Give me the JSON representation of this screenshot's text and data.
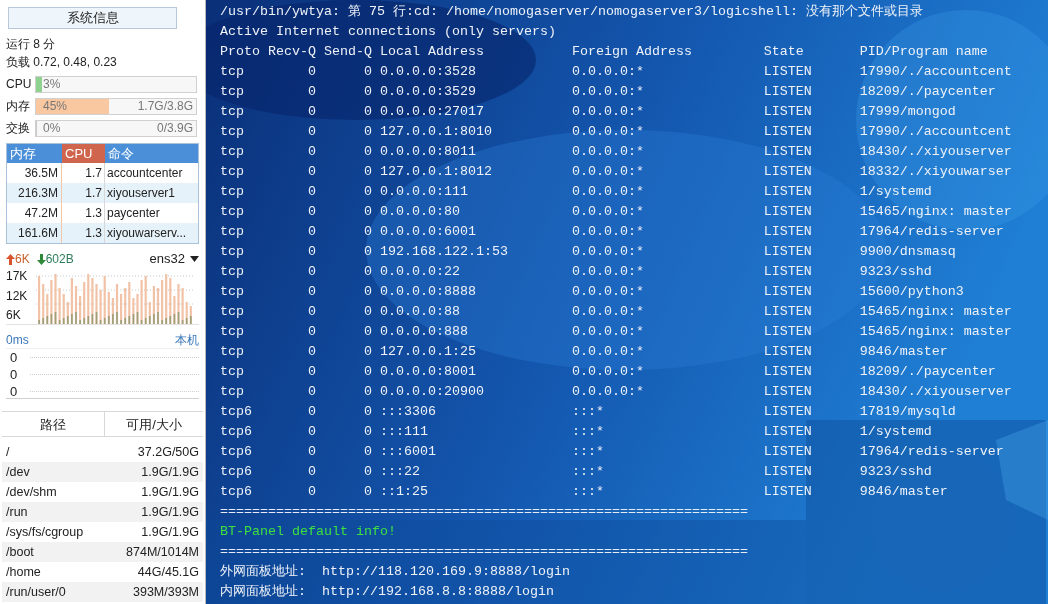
{
  "sidebar": {
    "title_button": "系统信息",
    "uptime": "运行 8 分",
    "load": "负载 0.72, 0.48, 0.23",
    "meters": [
      {
        "label": "CPU",
        "percent": "3%",
        "level": 0.03,
        "color": "#8fd18f"
      },
      {
        "label": "内存",
        "percent": "45%",
        "detail": "1.7G/3.8G",
        "level": 0.45,
        "color": "#f9c7a0"
      },
      {
        "label": "交换",
        "percent": "0%",
        "detail": "0/3.9G",
        "level": 0
      }
    ],
    "process_table": {
      "columns": [
        {
          "label": "内存",
          "selected": false
        },
        {
          "label": "CPU",
          "selected": true
        },
        {
          "label": "命令",
          "selected": false
        }
      ],
      "rows": [
        [
          "36.5M",
          "1.7",
          "accountcenter"
        ],
        [
          "216.3M",
          "1.7",
          "xiyouserver1"
        ],
        [
          "47.2M",
          "1.3",
          "paycenter"
        ],
        [
          "161.6M",
          "1.3",
          "xiyouwarserv..."
        ]
      ]
    },
    "network": {
      "upload": "6K",
      "download": "602B",
      "interface": "ens32",
      "tick_labels": [
        "17K",
        "12K",
        "6K"
      ]
    },
    "ping": {
      "latency": "0ms",
      "target": "本机",
      "values": [
        "0",
        "0",
        "0"
      ]
    },
    "disk_table": {
      "columns": [
        "路径",
        "可用/大小"
      ],
      "rows": [
        {
          "path": "/",
          "size": "37.2G/50G"
        },
        {
          "path": "/dev",
          "size": "1.9G/1.9G"
        },
        {
          "path": "/dev/shm",
          "size": "1.9G/1.9G"
        },
        {
          "path": "/run",
          "size": "1.9G/1.9G"
        },
        {
          "path": "/sys/fs/cgroup",
          "size": "1.9G/1.9G"
        },
        {
          "path": "/boot",
          "size": "874M/1014M"
        },
        {
          "path": "/home",
          "size": "44G/45.1G"
        },
        {
          "path": "/run/user/0",
          "size": "393M/393M"
        }
      ]
    }
  },
  "terminal": {
    "lines_before": [
      "/usr/bin/ywtya: 第 75 行:cd: /home/nomogaserver/nomogaserver3/logicshell: 没有那个文件或目录",
      "Active Internet connections (only servers)"
    ],
    "columns": [
      "Proto",
      "Recv-Q",
      "Send-Q",
      "Local Address",
      "Foreign Address",
      "State",
      "PID/Program name"
    ],
    "rows": [
      [
        "tcp",
        "0",
        "0",
        "0.0.0.0:3528",
        "0.0.0.0:*",
        "LISTEN",
        "17990/./accountcent"
      ],
      [
        "tcp",
        "0",
        "0",
        "0.0.0.0:3529",
        "0.0.0.0:*",
        "LISTEN",
        "18209/./paycenter"
      ],
      [
        "tcp",
        "0",
        "0",
        "0.0.0.0:27017",
        "0.0.0.0:*",
        "LISTEN",
        "17999/mongod"
      ],
      [
        "tcp",
        "0",
        "0",
        "127.0.0.1:8010",
        "0.0.0.0:*",
        "LISTEN",
        "17990/./accountcent"
      ],
      [
        "tcp",
        "0",
        "0",
        "0.0.0.0:8011",
        "0.0.0.0:*",
        "LISTEN",
        "18430/./xiyouserver"
      ],
      [
        "tcp",
        "0",
        "0",
        "127.0.0.1:8012",
        "0.0.0.0:*",
        "LISTEN",
        "18332/./xiyouwarser"
      ],
      [
        "tcp",
        "0",
        "0",
        "0.0.0.0:111",
        "0.0.0.0:*",
        "LISTEN",
        "1/systemd"
      ],
      [
        "tcp",
        "0",
        "0",
        "0.0.0.0:80",
        "0.0.0.0:*",
        "LISTEN",
        "15465/nginx: master"
      ],
      [
        "tcp",
        "0",
        "0",
        "0.0.0.0:6001",
        "0.0.0.0:*",
        "LISTEN",
        "17964/redis-server"
      ],
      [
        "tcp",
        "0",
        "0",
        "192.168.122.1:53",
        "0.0.0.0:*",
        "LISTEN",
        "9900/dnsmasq"
      ],
      [
        "tcp",
        "0",
        "0",
        "0.0.0.0:22",
        "0.0.0.0:*",
        "LISTEN",
        "9323/sshd"
      ],
      [
        "tcp",
        "0",
        "0",
        "0.0.0.0:8888",
        "0.0.0.0:*",
        "LISTEN",
        "15600/python3"
      ],
      [
        "tcp",
        "0",
        "0",
        "0.0.0.0:88",
        "0.0.0.0:*",
        "LISTEN",
        "15465/nginx: master"
      ],
      [
        "tcp",
        "0",
        "0",
        "0.0.0.0:888",
        "0.0.0.0:*",
        "LISTEN",
        "15465/nginx: master"
      ],
      [
        "tcp",
        "0",
        "0",
        "127.0.0.1:25",
        "0.0.0.0:*",
        "LISTEN",
        "9846/master"
      ],
      [
        "tcp",
        "0",
        "0",
        "0.0.0.0:8001",
        "0.0.0.0:*",
        "LISTEN",
        "18209/./paycenter"
      ],
      [
        "tcp",
        "0",
        "0",
        "0.0.0.0:20900",
        "0.0.0.0:*",
        "LISTEN",
        "18430/./xiyouserver"
      ],
      [
        "tcp6",
        "0",
        "0",
        ":::3306",
        ":::*",
        "LISTEN",
        "17819/mysqld"
      ],
      [
        "tcp6",
        "0",
        "0",
        ":::111",
        ":::*",
        "LISTEN",
        "1/systemd"
      ],
      [
        "tcp6",
        "0",
        "0",
        ":::6001",
        ":::*",
        "LISTEN",
        "17964/redis-server"
      ],
      [
        "tcp6",
        "0",
        "0",
        ":::22",
        ":::*",
        "LISTEN",
        "9323/sshd"
      ],
      [
        "tcp6",
        "0",
        "0",
        "::1:25",
        ":::*",
        "LISTEN",
        "9846/master"
      ]
    ],
    "lines_after": [
      {
        "kind": "rule",
        "text": "=================================================================="
      },
      {
        "kind": "highlight",
        "text": "BT-Panel default info!"
      },
      {
        "kind": "rule",
        "text": "=================================================================="
      },
      {
        "kind": "plain",
        "text": "外网面板地址:  http://118.120.169.9:8888/login"
      },
      {
        "kind": "plain",
        "text": "内网面板地址:  http://192.168.8.8:8888/login"
      }
    ]
  }
}
